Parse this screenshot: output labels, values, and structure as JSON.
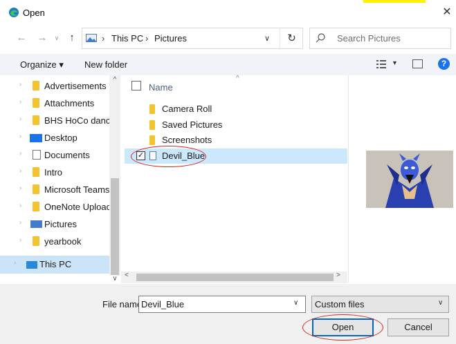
{
  "window": {
    "title": "Open",
    "close_label": "✕"
  },
  "address_bar": {
    "crumbs": [
      "This PC",
      "Pictures"
    ],
    "separator": "›"
  },
  "search": {
    "placeholder": "Search Pictures"
  },
  "toolbar": {
    "organize_label": "Organize ▾",
    "new_folder_label": "New folder",
    "help_label": "?"
  },
  "nav_pane": {
    "items": [
      {
        "label": "Advertisements (",
        "icon": "onedrive-folder-icon"
      },
      {
        "label": "Attachments",
        "icon": "folder-icon"
      },
      {
        "label": "BHS HoCo dance",
        "icon": "folder-icon"
      },
      {
        "label": "Desktop",
        "icon": "desktop-icon"
      },
      {
        "label": "Documents",
        "icon": "documents-icon"
      },
      {
        "label": "Intro",
        "icon": "folder-icon"
      },
      {
        "label": "Microsoft Teams",
        "icon": "folder-icon"
      },
      {
        "label": "OneNote Uploac",
        "icon": "folder-icon"
      },
      {
        "label": "Pictures",
        "icon": "pictures-icon"
      },
      {
        "label": "yearbook",
        "icon": "folder-icon"
      },
      {
        "label": "This PC",
        "icon": "computer-icon"
      }
    ]
  },
  "file_list": {
    "header_name": "Name",
    "rows": [
      {
        "label": "Camera Roll",
        "type": "folder"
      },
      {
        "label": "Saved Pictures",
        "type": "folder"
      },
      {
        "label": "Screenshots",
        "type": "folder"
      },
      {
        "label": "Devil_Blue",
        "type": "file",
        "selected": true,
        "check": "✓"
      }
    ]
  },
  "bottom": {
    "file_name_label": "File name:",
    "file_name_value": "Devil_Blue",
    "file_type_value": "Custom files",
    "open_label": "Open",
    "cancel_label": "Cancel"
  },
  "colors": {
    "accent": "#0067c0",
    "annotation": "#d9261c",
    "selection": "#cce8ff",
    "folder": "#f4c430",
    "highlight": "#fff200"
  }
}
